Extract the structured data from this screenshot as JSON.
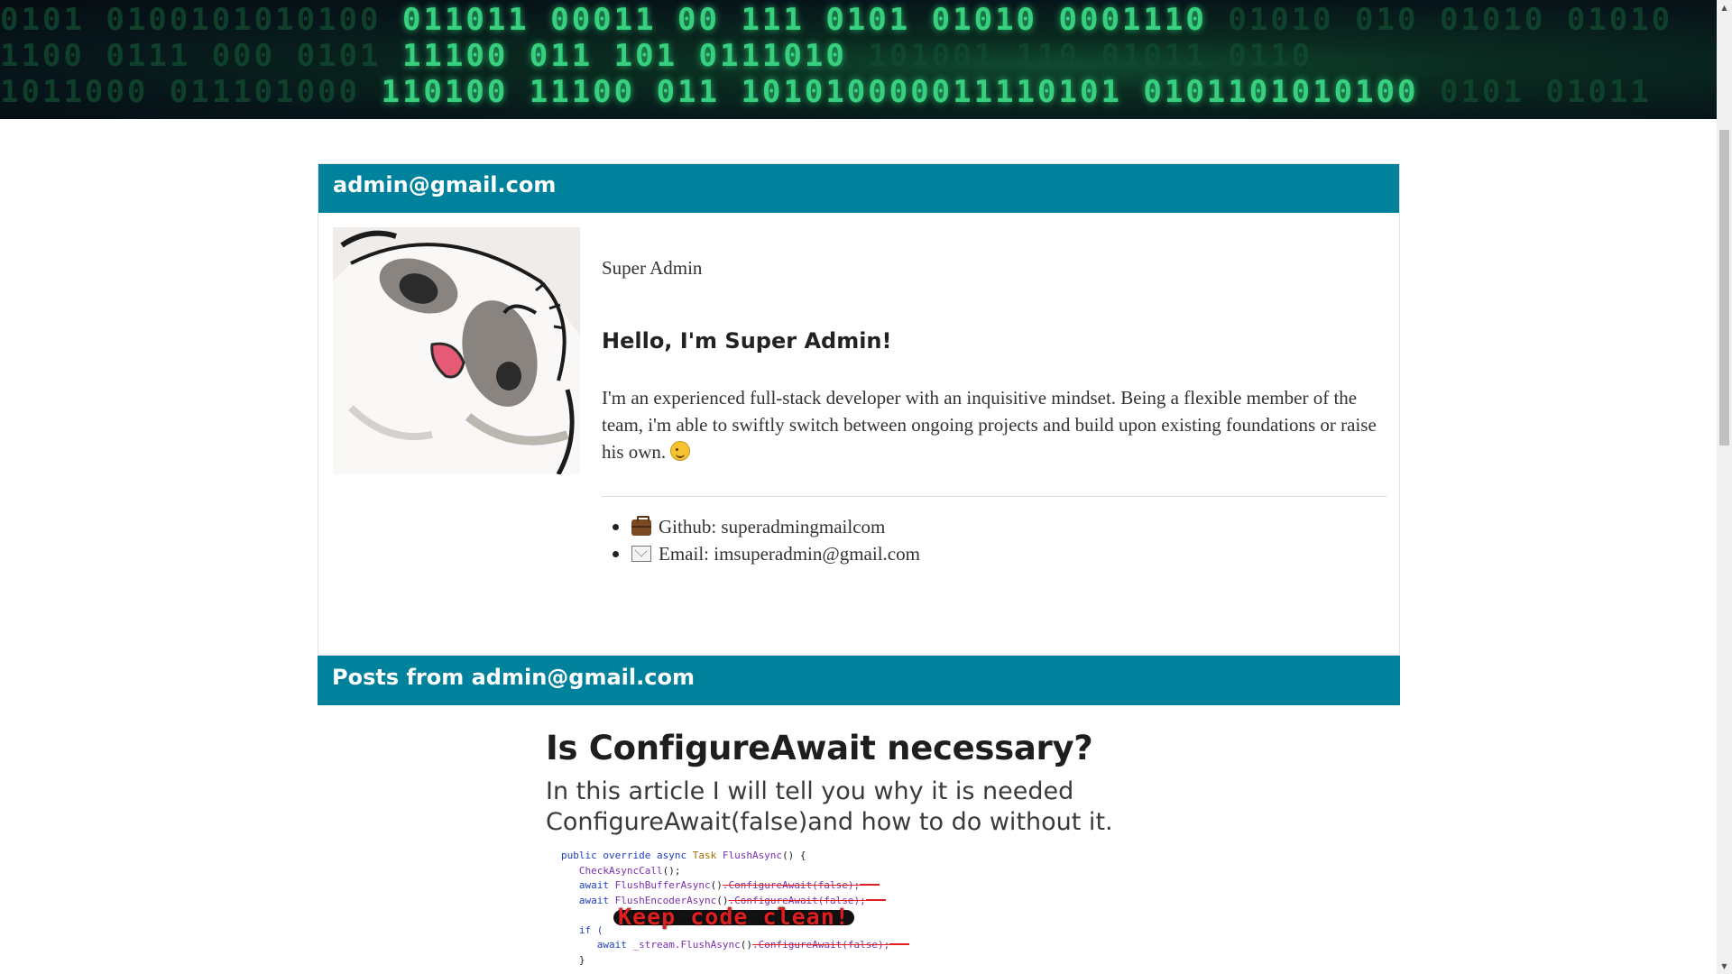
{
  "banner": {
    "row1": "0101 0100101010100 011011 00011  00 111 0101 01010   0001110 01010 010 01010 01010",
    "row2": "1100 0111 000 0101  11100 011 101        0111010    101001 110 01011 0110",
    "row3": "1011000 011101000 110100 11100 011 101010000011110101 0101101010100 0101 01011"
  },
  "profile": {
    "email": "admin@gmail.com",
    "role": "Super Admin",
    "greeting": "Hello, I'm Super Admin!",
    "bio": "I'm an experienced full-stack developer with an inquisitive mindset. Being a flexible member of the team, i'm able to swiftly switch between ongoing projects and build upon existing foundations or raise his own.",
    "links": [
      {
        "icon": "briefcase-icon",
        "text": "Github: superadmingmailcom"
      },
      {
        "icon": "envelope-icon",
        "text": "Email: imsuperadmin@gmail.com"
      }
    ]
  },
  "posts": {
    "header": "Posts from admin@gmail.com",
    "items": [
      {
        "title": "Is ConfigureAwait necessary?",
        "subtitle": "In this article I will tell you why it is needed ConfigureAwait(false)and how to do without it.",
        "image_caption": "Keep code clean!",
        "code": {
          "l1_k": "public override async ",
          "l1_t": "Task ",
          "l1_m": "FlushAsync",
          "l1_rest": "() {",
          "l2": "CheckAsyncCall",
          "l3_k": "await ",
          "l3_m": "FlushBufferAsync",
          "l3_s": ".ConfigureAwait(false);",
          "l4_k": "await ",
          "l4_m": "FlushEncoderAsync",
          "l4_s": ".ConfigureAwait(false);",
          "l5": "if (",
          "l6_k": "await ",
          "l6_m": "_stream.FlushAsync",
          "l6_s": ".ConfigureAwait(false);",
          "l7": "}"
        }
      }
    ]
  },
  "colors": {
    "accent": "#00819c",
    "banner_green": "#37d07f"
  }
}
